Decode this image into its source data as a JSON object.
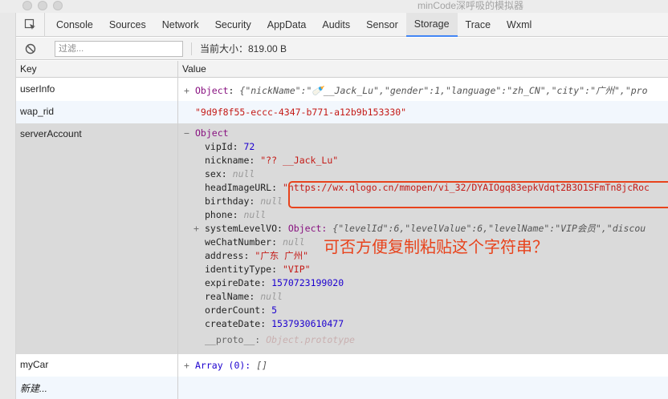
{
  "window": {
    "title": "minCode深呼吸的模拟器"
  },
  "tabs": [
    {
      "label": "Console"
    },
    {
      "label": "Sources"
    },
    {
      "label": "Network"
    },
    {
      "label": "Security"
    },
    {
      "label": "AppData"
    },
    {
      "label": "Audits"
    },
    {
      "label": "Sensor"
    },
    {
      "label": "Storage"
    },
    {
      "label": "Trace"
    },
    {
      "label": "Wxml"
    }
  ],
  "active_tab": "Storage",
  "toolbar": {
    "filter_placeholder": "过滤...",
    "size_text": "当前大小：819.00 B"
  },
  "table": {
    "headers": {
      "key": "Key",
      "value": "Value"
    },
    "rows": {
      "userInfo": {
        "key": "userInfo",
        "toggle": "+",
        "type": "Object",
        "preview": "{\"nickName\":\"🍼__Jack_Lu\",\"gender\":1,\"language\":\"zh_CN\",\"city\":\"广州\",\"pro"
      },
      "wap_rid": {
        "key": "wap_rid",
        "value": "\"9d9f8f55-eccc-4347-b771-a12b9b153330\""
      },
      "serverAccount": {
        "key": "serverAccount",
        "toggle": "−",
        "type": "Object",
        "props": {
          "vipId": {
            "name": "vipId:",
            "value": "72"
          },
          "nickname": {
            "name": "nickname:",
            "value": "\"?? __Jack_Lu\""
          },
          "sex": {
            "name": "sex:",
            "value": "null"
          },
          "headImageURL": {
            "name": "headImageURL:",
            "value": "\"https://wx.qlogo.cn/mmopen/vi_32/DYAIOgq83epkVdqt2B3O1SFmTn8jcRoc"
          },
          "birthday": {
            "name": "birthday:",
            "value": "null"
          },
          "phone": {
            "name": "phone:",
            "value": "null"
          },
          "systemLevelVO": {
            "toggle": "+",
            "name": "systemLevelVO:",
            "type": "Object:",
            "preview": "{\"levelId\":6,\"levelValue\":6,\"levelName\":\"VIP会员\",\"discou"
          },
          "weChatNumber": {
            "name": "weChatNumber:",
            "value": "null"
          },
          "address": {
            "name": "address:",
            "value": "\"广东 广州\""
          },
          "identityType": {
            "name": "identityType:",
            "value": "\"VIP\""
          },
          "expireDate": {
            "name": "expireDate:",
            "value": "1570723199020"
          },
          "realName": {
            "name": "realName:",
            "value": "null"
          },
          "orderCount": {
            "name": "orderCount:",
            "value": "5"
          },
          "createDate": {
            "name": "createDate:",
            "value": "1537930610477"
          },
          "proto": {
            "name": "__proto__:",
            "value": "Object.prototype"
          }
        }
      },
      "myCar": {
        "key": "myCar",
        "toggle": "+",
        "type": "Array (0):",
        "preview": "[]"
      },
      "new_entry": {
        "placeholder": "新建..."
      }
    }
  },
  "annotation": {
    "text": "可否方便复制粘贴这个字符串？",
    "color": "#e8431c"
  },
  "colors": {
    "accent": "#4285f4",
    "keyword": "#881280",
    "string": "#c41a16",
    "number": "#1c00cf"
  }
}
